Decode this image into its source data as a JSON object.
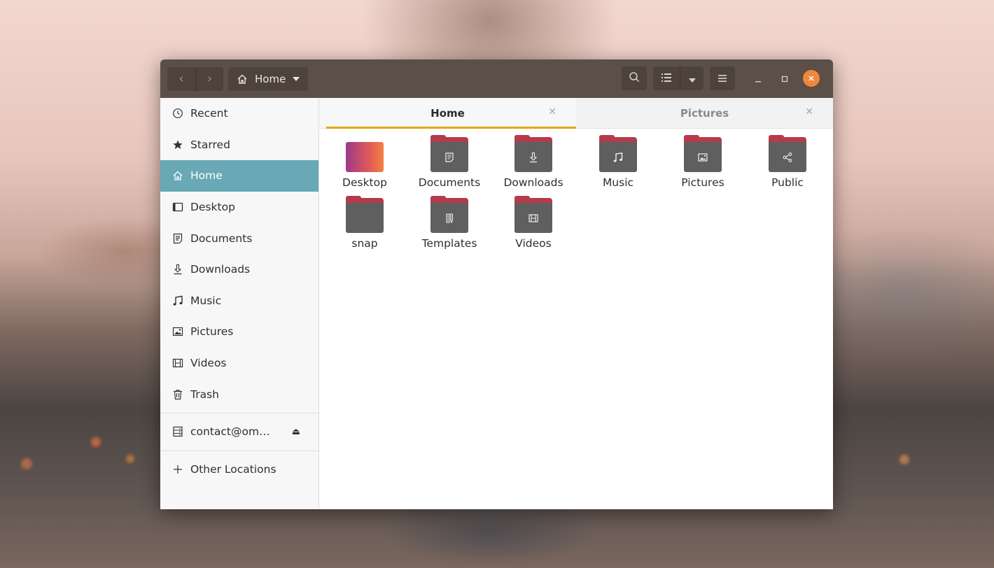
{
  "window": {
    "path_label": "Home"
  },
  "sidebar": {
    "items": [
      {
        "label": "Recent",
        "icon": "clock-icon"
      },
      {
        "label": "Starred",
        "icon": "star-icon"
      },
      {
        "label": "Home",
        "icon": "home-icon",
        "active": true
      },
      {
        "label": "Desktop",
        "icon": "desktop-icon"
      },
      {
        "label": "Documents",
        "icon": "document-icon"
      },
      {
        "label": "Downloads",
        "icon": "download-icon"
      },
      {
        "label": "Music",
        "icon": "music-icon"
      },
      {
        "label": "Pictures",
        "icon": "picture-icon"
      },
      {
        "label": "Videos",
        "icon": "video-icon"
      },
      {
        "label": "Trash",
        "icon": "trash-icon"
      }
    ],
    "network": {
      "label": "contact@om…",
      "icon": "server-icon"
    },
    "other": {
      "label": "Other Locations",
      "icon": "plus-icon"
    }
  },
  "tabs": [
    {
      "label": "Home",
      "active": true
    },
    {
      "label": "Pictures",
      "active": false
    }
  ],
  "files": [
    {
      "label": "Desktop",
      "icon": "desktop-folder-icon"
    },
    {
      "label": "Documents",
      "icon": "document-icon"
    },
    {
      "label": "Downloads",
      "icon": "download-icon"
    },
    {
      "label": "Music",
      "icon": "music-icon"
    },
    {
      "label": "Pictures",
      "icon": "picture-icon"
    },
    {
      "label": "Public",
      "icon": "share-icon"
    },
    {
      "label": "snap",
      "icon": "folder-icon"
    },
    {
      "label": "Templates",
      "icon": "template-icon"
    },
    {
      "label": "Videos",
      "icon": "video-icon"
    }
  ],
  "colors": {
    "headerbar": "#5b4f48",
    "sidebar_active": "#68a9b5",
    "tab_indicator": "#e5a50a",
    "close_button": "#f0883c",
    "folder_tab": "#b53a4c",
    "folder_body": "#5f5f5f"
  }
}
